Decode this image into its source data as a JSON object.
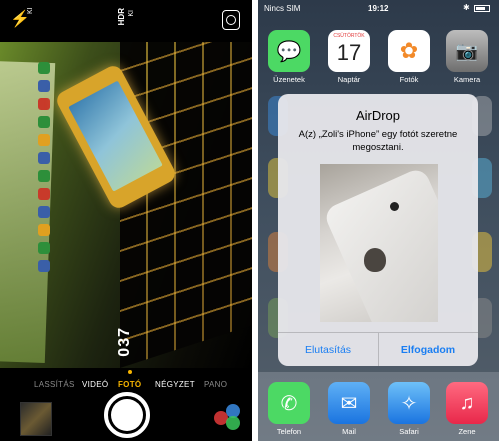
{
  "camera": {
    "flash_state": "KI",
    "hdr_label": "HDR",
    "hdr_state": "KI",
    "zoom_value": "037",
    "modes": [
      {
        "label": "LASSÍTÁS",
        "state": "dim"
      },
      {
        "label": "VIDEÓ",
        "state": "normal"
      },
      {
        "label": "FOTÓ",
        "state": "active"
      },
      {
        "label": "NÉGYZET",
        "state": "normal"
      },
      {
        "label": "PANO",
        "state": "dim"
      }
    ],
    "icons": {
      "flash": "flash-icon",
      "flip": "camera-flip-icon",
      "filters": "filters-icon"
    }
  },
  "home": {
    "status": {
      "carrier": "Nincs SIM",
      "time": "19:12"
    },
    "apps_row1": [
      {
        "label": "Üzenetek",
        "icon": "messages-icon",
        "color": "#4cd964"
      },
      {
        "label": "Naptár",
        "icon": "calendar-icon",
        "color": "#ffffff",
        "calendar_day": "17",
        "calendar_weekday": "CSÜTÖRTÖK"
      },
      {
        "label": "Fotók",
        "icon": "photos-icon",
        "color": "#ffffff"
      },
      {
        "label": "Kamera",
        "icon": "camera-icon",
        "color": "#9a9a9a"
      }
    ],
    "dock": [
      {
        "label": "Telefon",
        "icon": "phone-icon",
        "color": "#4cd964"
      },
      {
        "label": "Mail",
        "icon": "mail-icon",
        "color": "#2a8cf0"
      },
      {
        "label": "Safari",
        "icon": "safari-icon",
        "color": "#2a8cf0"
      },
      {
        "label": "Zene",
        "icon": "music-icon",
        "color": "#fb3b5a"
      }
    ]
  },
  "airdrop": {
    "title": "AirDrop",
    "message": "A(z) „Zoli's iPhone” egy fotót szeretne megosztani.",
    "decline_label": "Elutasítás",
    "accept_label": "Elfogadom"
  }
}
